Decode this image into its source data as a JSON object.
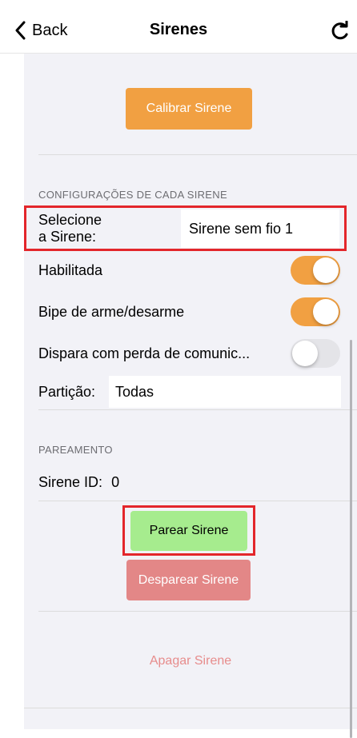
{
  "nav": {
    "back_label": "Back",
    "title": "Sirenes",
    "back_icon": "chevron-left-icon",
    "refresh_icon": "refresh-icon"
  },
  "calibrate": {
    "label": "Calibrar Sirene"
  },
  "config": {
    "section_title": "CONFIGURAÇÕES DE CADA SIRENE",
    "select_label_line1": "Selecione",
    "select_label_line2": "a Sirene:",
    "selected_siren": "Sirene sem fio 1",
    "rows": [
      {
        "label": "Habilitada",
        "on": true
      },
      {
        "label": "Bipe de arme/desarme",
        "on": true
      },
      {
        "label": "Dispara com perda de comunic...",
        "on": false
      }
    ],
    "partition_label": "Partição:",
    "partition_value": "Todas"
  },
  "pairing": {
    "section_title": "PAREAMENTO",
    "siren_id_label": "Sirene ID:",
    "siren_id_value": "0",
    "pair_label": "Parear Sirene",
    "unpair_label": "Desparear Sirene"
  },
  "delete_label": "Apagar Sirene",
  "colors": {
    "orange": "#f1a042",
    "green": "#a6ec8e",
    "red": "#e38787",
    "delete_text": "#e78c8c",
    "highlight": "#e3262b"
  }
}
